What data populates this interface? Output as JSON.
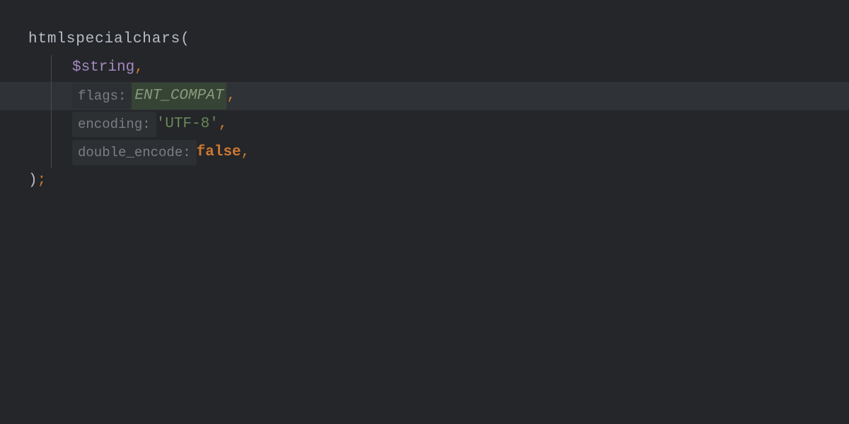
{
  "code": {
    "function_name": "htmlspecialchars",
    "open_paren": "(",
    "close_paren": ")",
    "semicolon": ";",
    "lines": [
      {
        "variable": "$string",
        "comma": ","
      },
      {
        "param_hint": "flags:",
        "value": "ENT_COMPAT",
        "value_type": "constant",
        "comma": ",",
        "highlighted": true
      },
      {
        "param_hint": "encoding:",
        "value": "'UTF-8'",
        "value_type": "string",
        "comma": ","
      },
      {
        "param_hint": "double_encode:",
        "value": "false",
        "value_type": "keyword",
        "comma": ","
      }
    ]
  }
}
